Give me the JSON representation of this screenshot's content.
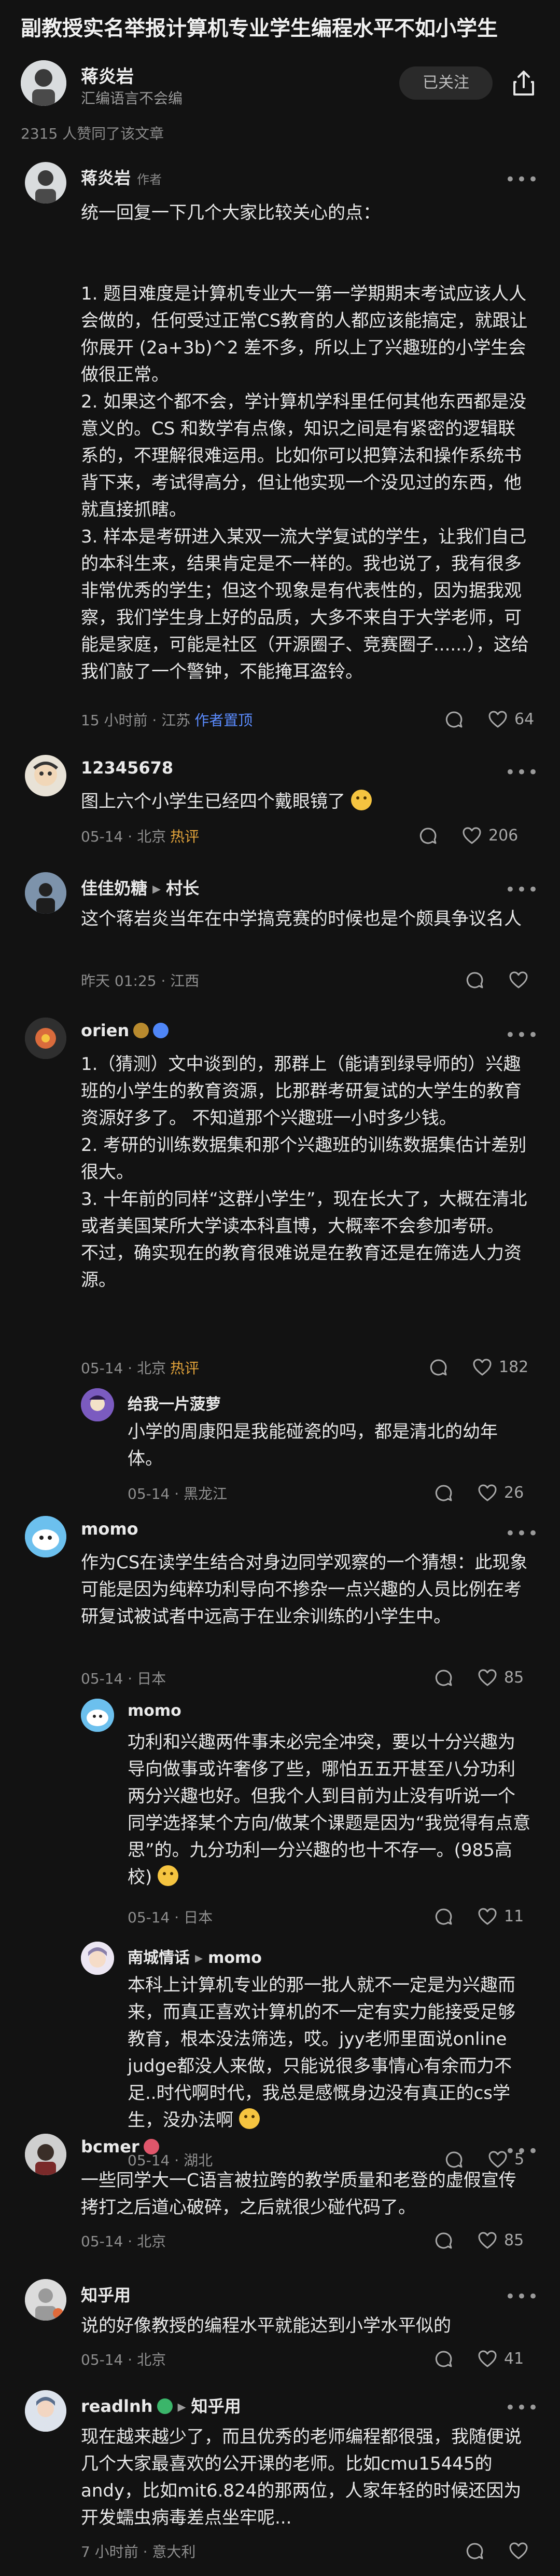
{
  "question": {
    "title": "副教授实名举报计算机专业学生编程水平不如小学生"
  },
  "author": {
    "name": "蒋炎岩",
    "bio": "汇编语言不会编",
    "follow_label": "已关注",
    "approve_text": "2315 人赞同了该文章"
  },
  "colors": {
    "background": "#121212",
    "hot": "#e0a23a",
    "pinned": "#5b8cff"
  },
  "icons": {
    "share": "share-icon",
    "comment": "comment-icon",
    "like": "heart-icon",
    "more": "more-dots-icon"
  },
  "comments": [
    {
      "name": "蒋炎岩",
      "tag": "作者",
      "text": "统一回复一下几个大家比较关心的点：\n\n\n1. 题目难度是计算机专业大一第一学期期末考试应该人人会做的，任何受过正常CS教育的人都应该能搞定，就跟让你展开 (2a+3b)^2 差不多，所以上了兴趣班的小学生会做很正常。\n2. 如果这个都不会，学计算机学科里任何其他东西都是没意义的。CS 和数学有点像，知识之间是有紧密的逻辑联系的，不理解很难运用。比如你可以把算法和操作系统书背下来，考试得高分，但让他实现一个没见过的东西，他就直接抓瞎。\n3. 样本是考研进入某双一流大学复试的学生，让我们自己的本科生来，结果肯定是不一样的。我也说了，我有很多非常优秀的学生；但这个现象是有代表性的，因为据我观察，我们学生身上好的品质，大多不来自于大学老师，可能是家庭，可能是社区（开源圈子、竞赛圈子......），这给我们敲了一个警钟，不能掩耳盗铃。",
      "time": "15 小时前 · 江苏",
      "badge": "作者置顶",
      "likes": "64"
    },
    {
      "name": "12345678",
      "text": "图上六个小学生已经四个戴眼镜了",
      "time": "05-14 · 北京",
      "badge": "热评",
      "likes": "206"
    },
    {
      "name": "佳佳奶糖",
      "reply_to": "村长",
      "text": "这个蒋岩炎当年在中学搞竞赛的时候也是个颇具争议名人",
      "time": "昨天 01:25 · 江西",
      "likes": ""
    },
    {
      "name": "orien",
      "text": "1.（猜测）文中谈到的，那群上（能请到绿导师的）兴趣班的小学生的教育资源，比那群考研复试的大学生的教育资源好多了。 不知道那个兴趣班一小时多少钱。\n2. 考研的训练数据集和那个兴趣班的训练数据集估计差别很大。\n3. 十年前的同样“这群小学生”，现在长大了，大概在清北或者美国某所大学读本科直博，大概率不会参加考研。\n不过，确实现在的教育很难说是在教育还是在筛选人力资源。",
      "time": "05-14 · 北京",
      "badge": "热评",
      "likes": "182"
    },
    {
      "name": "给我一片菠萝",
      "text": "小学的周康阳是我能碰瓷的吗，都是清北的幼年体。",
      "time": "05-14 · 黑龙江",
      "likes": "26"
    },
    {
      "name": "momo",
      "text": "作为CS在读学生结合对身边同学观察的一个猜想：此现象可能是因为纯粹功利导向不掺杂一点兴趣的人员比例在考研复试被试者中远高于在业余训练的小学生中。",
      "time": "05-14 · 日本",
      "likes": "85"
    },
    {
      "name": "momo",
      "text": "功利和兴趣两件事未必完全冲突，要以十分兴趣为导向做事或许奢侈了些，哪怕五五开甚至八分功利两分兴趣也好。但我个人到目前为止没有听说一个同学选择某个方向/做某个课题是因为“我觉得有点意思”的。九分功利一分兴趣的也十不存一。(985高校)",
      "time": "05-14 · 日本",
      "likes": "11"
    },
    {
      "name": "南城情话",
      "reply_to": "momo",
      "text": "本科上计算机专业的那一批人就不一定是为兴趣而来，而真正喜欢计算机的不一定有实力能接受足够教育，根本没法筛选，哎。jyy老师里面说online judge都没人来做，只能说很多事情心有余而力不足..时代啊时代，我总是感慨身边没有真正的cs学生，没办法啊",
      "time": "05-14 · 湖北",
      "likes": "5"
    },
    {
      "name": "bcmer",
      "text": "一些同学大一C语言被拉跨的教学质量和老登的虚假宣传拷打之后道心破碎，之后就很少碰代码了。",
      "time": "05-14 · 北京",
      "likes": "85"
    },
    {
      "name": "知乎用",
      "text": "说的好像教授的编程水平就能达到小学水平似的",
      "time": "05-14 · 北京",
      "likes": "41"
    },
    {
      "name": "readlnh",
      "reply_to": "知乎用",
      "text": "现在越来越少了，而且优秀的老师编程都很强，我随便说几个大家最喜欢的公开课的老师。比如cmu15445的andy，比如mit6.824的那两位，人家年轻的时候还因为开发蠕虫病毒差点坐牢呢...",
      "time": "7 小时前 · 意大利",
      "likes": ""
    }
  ]
}
